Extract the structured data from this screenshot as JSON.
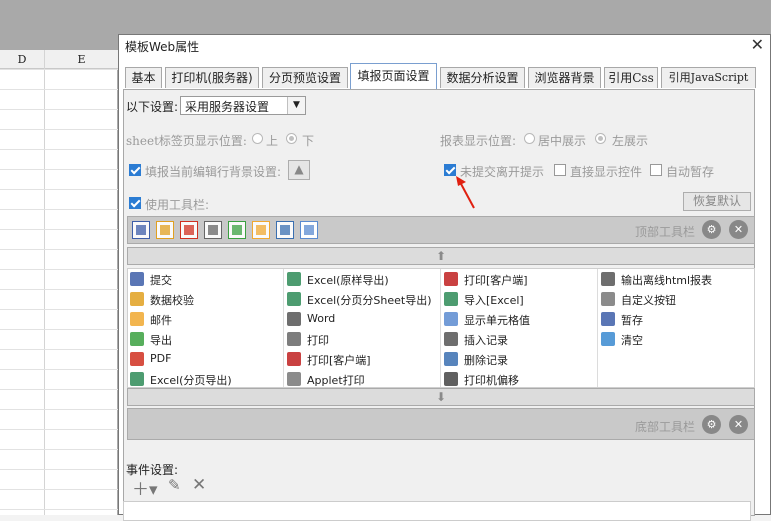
{
  "background": {
    "columns": [
      "D",
      "E"
    ]
  },
  "dialog": {
    "title": "模板Web属性",
    "close_glyph": "✕",
    "tabs": [
      {
        "label": "基本"
      },
      {
        "label": "打印机(服务器)"
      },
      {
        "label": "分页预览设置"
      },
      {
        "label": "填报页面设置"
      },
      {
        "label": "数据分析设置"
      },
      {
        "label": "浏览器背景"
      },
      {
        "label": "引用Css"
      },
      {
        "label": "引用JavaScript"
      }
    ],
    "active_tab": "填报页面设置"
  },
  "settings": {
    "mode_label": "以下设置:",
    "mode_value": "采用服务器设置",
    "sheet_tab_label": "sheet标签页显示位置:",
    "sheet_tab_options": [
      "上",
      "下"
    ],
    "sheet_tab_selected": "下",
    "report_pos_label": "报表显示位置:",
    "report_pos_options": [
      "居中展示",
      "左展示"
    ],
    "report_pos_selected": "左展示",
    "fill_bg_label": "填报当前编辑行背景设置:",
    "fill_bg_checked": true,
    "unsubmitted_label": "未提交离开提示",
    "unsubmitted_checked": true,
    "show_widget_label": "直接显示控件",
    "show_widget_checked": false,
    "autosave_label": "自动暂存",
    "autosave_checked": false,
    "use_toolbar_label": "使用工具栏:",
    "use_toolbar_checked": true,
    "restore_default_label": "恢复默认"
  },
  "toolbar": {
    "top_label": "顶部工具栏",
    "bottom_label": "底部工具栏",
    "icons": [
      "save-icon",
      "validate-icon",
      "pdf-print-icon",
      "print-icon",
      "export-icon",
      "mail-icon",
      "insert-icon",
      "blank-icon"
    ]
  },
  "items": [
    [
      {
        "label": "提交",
        "icon": "submit-icon",
        "color": "#3d5ea8"
      },
      {
        "label": "数据校验",
        "icon": "validate-icon",
        "color": "#e0a020"
      },
      {
        "label": "邮件",
        "icon": "mail-icon",
        "color": "#f0a830"
      },
      {
        "label": "导出",
        "icon": "export-icon",
        "color": "#3aa040"
      },
      {
        "label": "PDF",
        "icon": "pdf-icon",
        "color": "#d03020"
      },
      {
        "label": "Excel(分页导出)",
        "icon": "excel-icon",
        "color": "#2e8b57"
      }
    ],
    [
      {
        "label": "Excel(原样导出)",
        "icon": "excel-icon",
        "color": "#2e8b57"
      },
      {
        "label": "Excel(分页分Sheet导出)",
        "icon": "excel-icon",
        "color": "#2e8b57"
      },
      {
        "label": "Word",
        "icon": "word-icon",
        "color": "#555555"
      },
      {
        "label": "打印",
        "icon": "print-icon",
        "color": "#666666"
      },
      {
        "label": "打印[客户端]",
        "icon": "pdf-print-icon",
        "color": "#c02020"
      },
      {
        "label": "Applet打印",
        "icon": "applet-print-icon",
        "color": "#777777"
      }
    ],
    [
      {
        "label": "打印[客户端]",
        "icon": "pdf-print-icon",
        "color": "#c02020"
      },
      {
        "label": "导入[Excel]",
        "icon": "import-excel-icon",
        "color": "#2e8b57"
      },
      {
        "label": "显示单元格值",
        "icon": "cell-value-icon",
        "color": "#5b8bd0"
      },
      {
        "label": "插入记录",
        "icon": "insert-record-icon",
        "color": "#555555"
      },
      {
        "label": "删除记录",
        "icon": "delete-record-icon",
        "color": "#3a6fb0"
      },
      {
        "label": "打印机偏移",
        "icon": "printer-offset-icon",
        "color": "#444444"
      }
    ],
    [
      {
        "label": "输出离线html报表",
        "icon": "offline-html-icon",
        "color": "#555555"
      },
      {
        "label": "自定义按钮",
        "icon": "gear-icon",
        "color": "#777777"
      },
      {
        "label": "暂存",
        "icon": "temp-save-icon",
        "color": "#3d5ea8"
      },
      {
        "label": "清空",
        "icon": "eraser-icon",
        "color": "#3a8ad0"
      }
    ]
  ],
  "events": {
    "label": "事件设置:"
  }
}
